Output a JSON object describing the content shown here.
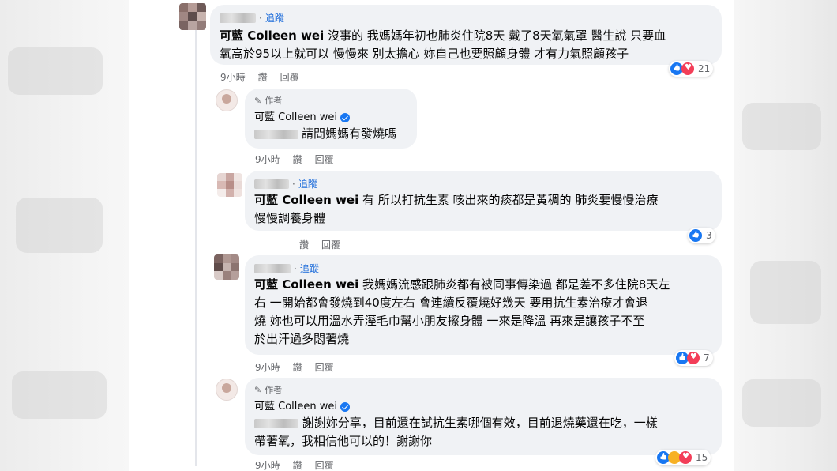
{
  "thread": {
    "more_label": "···",
    "comments": [
      {
        "follow": "追蹤",
        "mention": "可藍 Colleen wei",
        "text_line1": " 沒事的 我媽媽年初也肺炎住院8天 戴了8天氧氣罩 醫生說 只要血",
        "text_line2": "氧高於95以上就可以 慢慢來 別太擔心 妳自己也要照顧身體 才有力氣照顧孩子",
        "time": "9小時",
        "like": "讚",
        "reply": "回覆",
        "reaction_count": "21"
      },
      {
        "author_tag": "作者",
        "name": "可藍 Colleen wei",
        "text": "請問媽媽有發燒嗎",
        "time": "9小時",
        "like": "讚",
        "reply": "回覆"
      },
      {
        "follow": "追蹤",
        "mention": "可藍 Colleen wei",
        "text_line1": " 有 所以打抗生素 咳出來的痰都是黃稠的 肺炎要慢慢治療",
        "text_line2": "慢慢調養身體",
        "like": "讚",
        "reply": "回覆",
        "reaction_count": "3"
      },
      {
        "follow": "追蹤",
        "mention": "可藍 Colleen wei",
        "text_line1": " 我媽媽流感跟肺炎都有被同事傳染過 都是差不多住院8天左",
        "text_line2": "右 一開始都會發燒到40度左右 會連續反覆燒好幾天 要用抗生素治療才會退",
        "text_line3": "燒 妳也可以用溫水弄溼毛巾幫小朋友擦身體 一來是降溫 再來是讓孩子不至",
        "text_line4": "於出汗過多悶著燒",
        "time": "9小時",
        "like": "讚",
        "reply": "回覆",
        "reaction_count": "7"
      },
      {
        "author_tag": "作者",
        "name": "可藍 Colleen wei",
        "text_line1": "謝謝妳分享，目前還在試抗生素哪個有效，目前退燒藥還在吃，一樣",
        "text_line2": "帶著氧，我相信他可以的！謝謝你",
        "time": "9小時",
        "like": "讚",
        "reply": "回覆",
        "reaction_count": "15"
      }
    ]
  },
  "colors": {
    "bubble_bg": "#f0f2f5",
    "link_blue": "#216fdb",
    "meta_gray": "#65676b",
    "like_blue": "#1877f2",
    "love_red": "#f33e58"
  }
}
